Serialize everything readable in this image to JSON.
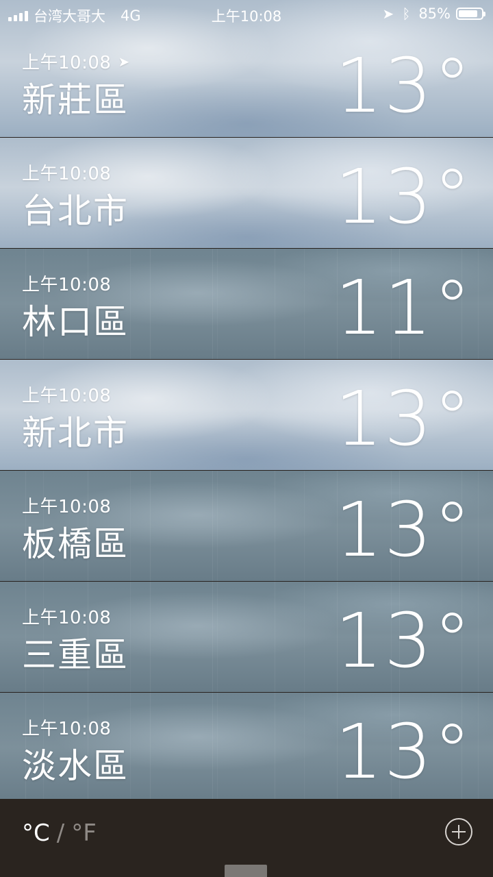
{
  "status_bar": {
    "carrier": "台湾大哥大",
    "network": "4G",
    "time": "上午10:08",
    "battery": "85%",
    "battery_level": 0.85,
    "location_icon": "location-arrow-icon",
    "bluetooth_icon": "bluetooth-icon"
  },
  "cities": [
    {
      "time": "上午10:08",
      "name": "新莊區",
      "temp": "13°",
      "current_location": true,
      "sky": "light"
    },
    {
      "time": "上午10:08",
      "name": "台北市",
      "temp": "13°",
      "current_location": false,
      "sky": "light"
    },
    {
      "time": "上午10:08",
      "name": "林口區",
      "temp": "11°",
      "current_location": false,
      "sky": "dark"
    },
    {
      "time": "上午10:08",
      "name": "新北市",
      "temp": "13°",
      "current_location": false,
      "sky": "light"
    },
    {
      "time": "上午10:08",
      "name": "板橋區",
      "temp": "13°",
      "current_location": false,
      "sky": "dark"
    },
    {
      "time": "上午10:08",
      "name": "三重區",
      "temp": "13°",
      "current_location": false,
      "sky": "dark"
    },
    {
      "time": "上午10:08",
      "name": "淡水區",
      "temp": "13°",
      "current_location": false,
      "sky": "dark"
    }
  ],
  "bottom_bar": {
    "unit_c": "°C",
    "separator": "/",
    "unit_f": "°F",
    "add_icon": "plus-circle-icon"
  },
  "colors": {
    "bottom_bar_bg": "#2a241f",
    "text": "#ffffff",
    "inactive_unit": "#8f8a86"
  }
}
